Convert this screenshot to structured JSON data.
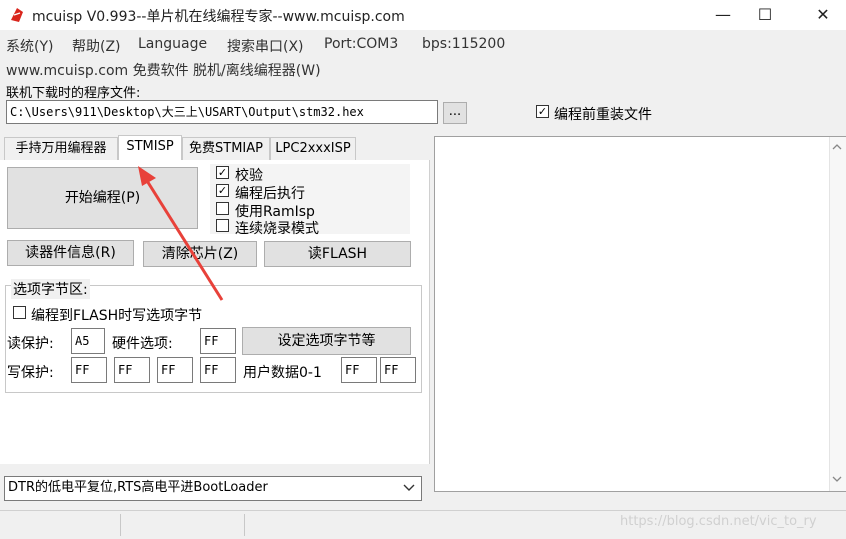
{
  "window": {
    "title": "mcuisp V0.993--单片机在线编程专家--www.mcuisp.com",
    "minimize": "—",
    "maximize": "☐",
    "close": "✕"
  },
  "menu": {
    "row1": [
      "系统(Y)",
      "帮助(Z)",
      "Language",
      "搜索串口(X)",
      "Port:COM3",
      "bps:115200"
    ],
    "row2": [
      "www.mcuisp.com 免费软件 脱机/离线编程器(W)"
    ]
  },
  "file": {
    "label": "联机下载时的程序文件:",
    "path": "C:\\Users\\911\\Desktop\\大三上\\USART\\Output\\stm32.hex",
    "browse": "...",
    "reload_label": "编程前重装文件",
    "reload_checked": true
  },
  "tabs": [
    {
      "label": "手持万用编程器",
      "active": false
    },
    {
      "label": "STMISP",
      "active": true
    },
    {
      "label": "免费STMIAP",
      "active": false
    },
    {
      "label": "LPC2xxxISP",
      "active": false
    }
  ],
  "stmisp": {
    "start_button": "开始编程(P)",
    "options": [
      {
        "label": "校验",
        "checked": true
      },
      {
        "label": "编程后执行",
        "checked": true
      },
      {
        "label": "使用RamIsp",
        "checked": false
      },
      {
        "label": "连续烧录模式",
        "checked": false
      }
    ],
    "read_info_button": "读器件信息(R)",
    "erase_button": "清除芯片(Z)",
    "read_flash_button": "读FLASH",
    "option_bytes": {
      "group_title": "选项字节区:",
      "write_option_label": "编程到FLASH时写选项字节",
      "write_option_checked": false,
      "read_protect_label": "读保护:",
      "read_protect_value": "A5",
      "hw_option_label": "硬件选项:",
      "hw_option_value": "FF",
      "set_button": "设定选项字节等",
      "write_protect_label": "写保护:",
      "write_protect_values": [
        "FF",
        "FF",
        "FF",
        "FF"
      ],
      "user_data_label": "用户数据0-1",
      "user_data_values": [
        "FF",
        "FF"
      ]
    },
    "reset_mode": "DTR的低电平复位,RTS高电平进BootLoader"
  },
  "watermark": "https://blog.csdn.net/vic_to_ry",
  "colors": {
    "arrow": "#e8413a",
    "app_icon": "#d9251c"
  }
}
